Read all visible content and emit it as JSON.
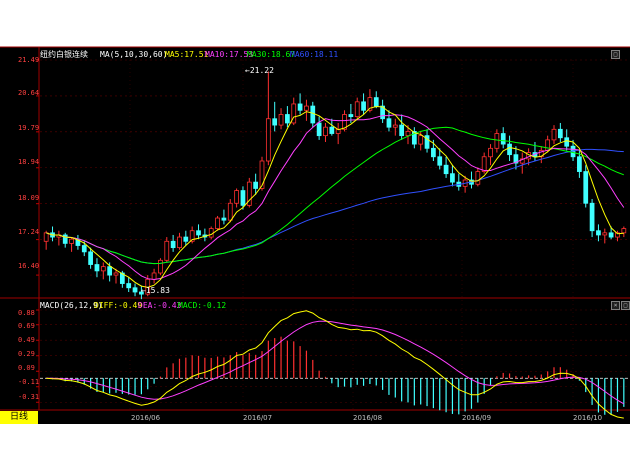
{
  "main_panel": {
    "name": "纽约白银连续",
    "ma_params": "MA(5,10,30,60)",
    "ma5": "MA5:17.51",
    "ma10": "MA10:17.53",
    "ma30": "MA30:18.67",
    "ma60": "MA60:18.11",
    "high_marker": "21.22",
    "low_marker": "15.83",
    "price_ticks": [
      "21.49",
      "20.64",
      "19.79",
      "18.94",
      "18.09",
      "17.24",
      "16.40"
    ]
  },
  "macd_panel": {
    "params": "MACD(26,12,9)",
    "diff": "DIFF:-0.49",
    "dea": "DEA:-0.43",
    "macd": "MACD:-0.12",
    "ticks": [
      "0.88",
      "0.69",
      "0.49",
      "0.29",
      "0.09",
      "-0.11",
      "-0.31"
    ]
  },
  "footer": {
    "period_label": "日线",
    "dates": [
      "2016/06",
      "2016/07",
      "2016/08",
      "2016/09",
      "2016/10"
    ]
  },
  "colors": {
    "up": "#ff3030",
    "down": "#40ffff",
    "ma5": "#ffff00",
    "ma10": "#ff40ff",
    "ma30": "#00ff00",
    "ma60": "#3050ff",
    "diff": "#ffff00",
    "dea": "#ff40ff",
    "axis": "#c00000"
  },
  "chart_data": {
    "type": "candlestick",
    "title": "纽约白银连续",
    "ylim": [
      16.0,
      21.49
    ],
    "candles": [
      [
        17.2,
        17.45,
        17.0,
        17.4
      ],
      [
        17.4,
        17.55,
        17.2,
        17.3
      ],
      [
        17.3,
        17.45,
        17.1,
        17.35
      ],
      [
        17.35,
        17.4,
        17.05,
        17.15
      ],
      [
        17.15,
        17.3,
        16.95,
        17.25
      ],
      [
        17.25,
        17.35,
        17.0,
        17.1
      ],
      [
        17.1,
        17.2,
        16.85,
        16.95
      ],
      [
        16.95,
        17.05,
        16.55,
        16.65
      ],
      [
        16.65,
        16.8,
        16.35,
        16.5
      ],
      [
        16.5,
        16.7,
        16.3,
        16.6
      ],
      [
        16.6,
        16.7,
        16.25,
        16.4
      ],
      [
        16.4,
        16.55,
        16.2,
        16.45
      ],
      [
        16.45,
        16.5,
        16.1,
        16.2
      ],
      [
        16.2,
        16.35,
        16.0,
        16.1
      ],
      [
        16.1,
        16.2,
        15.9,
        16.0
      ],
      [
        16.0,
        16.15,
        15.83,
        15.95
      ],
      [
        15.95,
        16.4,
        15.9,
        16.3
      ],
      [
        16.3,
        16.55,
        16.2,
        16.45
      ],
      [
        16.45,
        16.8,
        16.4,
        16.75
      ],
      [
        16.75,
        17.3,
        16.7,
        17.2
      ],
      [
        17.2,
        17.35,
        16.95,
        17.05
      ],
      [
        17.05,
        17.4,
        17.0,
        17.3
      ],
      [
        17.3,
        17.45,
        17.1,
        17.2
      ],
      [
        17.2,
        17.55,
        17.15,
        17.45
      ],
      [
        17.45,
        17.6,
        17.25,
        17.35
      ],
      [
        17.35,
        17.5,
        17.2,
        17.3
      ],
      [
        17.3,
        17.55,
        17.25,
        17.5
      ],
      [
        17.5,
        17.8,
        17.45,
        17.75
      ],
      [
        17.75,
        17.95,
        17.6,
        17.7
      ],
      [
        17.7,
        18.2,
        17.65,
        18.1
      ],
      [
        18.1,
        18.45,
        18.0,
        18.4
      ],
      [
        18.4,
        18.5,
        17.95,
        18.05
      ],
      [
        18.05,
        18.7,
        18.0,
        18.6
      ],
      [
        18.6,
        18.8,
        18.3,
        18.45
      ],
      [
        18.45,
        19.2,
        18.4,
        19.1
      ],
      [
        19.1,
        21.22,
        19.0,
        20.1
      ],
      [
        20.1,
        20.5,
        19.8,
        19.95
      ],
      [
        19.95,
        20.35,
        19.85,
        20.2
      ],
      [
        20.2,
        20.4,
        19.9,
        20.0
      ],
      [
        20.0,
        20.6,
        19.95,
        20.45
      ],
      [
        20.45,
        20.7,
        20.2,
        20.3
      ],
      [
        20.3,
        20.55,
        20.05,
        20.4
      ],
      [
        20.4,
        20.5,
        19.9,
        20.0
      ],
      [
        20.0,
        20.15,
        19.6,
        19.7
      ],
      [
        19.7,
        20.0,
        19.55,
        19.9
      ],
      [
        19.9,
        20.1,
        19.7,
        19.75
      ],
      [
        19.75,
        20.0,
        19.5,
        19.85
      ],
      [
        19.85,
        20.3,
        19.8,
        20.2
      ],
      [
        20.2,
        20.45,
        20.0,
        20.15
      ],
      [
        20.15,
        20.6,
        20.1,
        20.5
      ],
      [
        20.5,
        20.7,
        20.2,
        20.3
      ],
      [
        20.3,
        20.8,
        20.25,
        20.6
      ],
      [
        20.6,
        20.75,
        20.35,
        20.4
      ],
      [
        20.4,
        20.55,
        20.0,
        20.1
      ],
      [
        20.1,
        20.3,
        19.8,
        19.9
      ],
      [
        19.9,
        20.1,
        19.7,
        19.95
      ],
      [
        19.95,
        20.2,
        19.6,
        19.7
      ],
      [
        19.7,
        19.95,
        19.5,
        19.8
      ],
      [
        19.8,
        19.9,
        19.4,
        19.5
      ],
      [
        19.5,
        19.8,
        19.35,
        19.7
      ],
      [
        19.7,
        19.85,
        19.3,
        19.4
      ],
      [
        19.4,
        19.6,
        19.1,
        19.2
      ],
      [
        19.2,
        19.4,
        18.9,
        19.0
      ],
      [
        19.0,
        19.2,
        18.7,
        18.8
      ],
      [
        18.8,
        19.0,
        18.5,
        18.6
      ],
      [
        18.6,
        18.8,
        18.4,
        18.5
      ],
      [
        18.5,
        18.75,
        18.35,
        18.65
      ],
      [
        18.65,
        18.85,
        18.45,
        18.55
      ],
      [
        18.55,
        18.95,
        18.5,
        18.85
      ],
      [
        18.85,
        19.3,
        18.8,
        19.2
      ],
      [
        19.2,
        19.5,
        19.0,
        19.4
      ],
      [
        19.4,
        19.85,
        19.3,
        19.75
      ],
      [
        19.75,
        19.9,
        19.4,
        19.5
      ],
      [
        19.5,
        19.7,
        19.1,
        19.25
      ],
      [
        19.25,
        19.45,
        18.9,
        19.05
      ],
      [
        19.05,
        19.3,
        18.8,
        19.15
      ],
      [
        19.15,
        19.4,
        19.0,
        19.3
      ],
      [
        19.3,
        19.55,
        19.1,
        19.2
      ],
      [
        19.2,
        19.45,
        19.05,
        19.35
      ],
      [
        19.35,
        19.7,
        19.3,
        19.6
      ],
      [
        19.6,
        19.95,
        19.5,
        19.85
      ],
      [
        19.85,
        20.0,
        19.55,
        19.65
      ],
      [
        19.65,
        19.85,
        19.35,
        19.45
      ],
      [
        19.45,
        19.6,
        19.1,
        19.2
      ],
      [
        19.2,
        19.35,
        18.7,
        18.85
      ],
      [
        18.85,
        19.0,
        18.0,
        18.1
      ],
      [
        18.1,
        18.2,
        17.3,
        17.45
      ],
      [
        17.45,
        17.6,
        17.2,
        17.35
      ],
      [
        17.35,
        17.5,
        17.15,
        17.4
      ],
      [
        17.4,
        17.55,
        17.25,
        17.3
      ],
      [
        17.3,
        17.45,
        17.2,
        17.4
      ],
      [
        17.4,
        17.55,
        17.3,
        17.5
      ]
    ]
  }
}
